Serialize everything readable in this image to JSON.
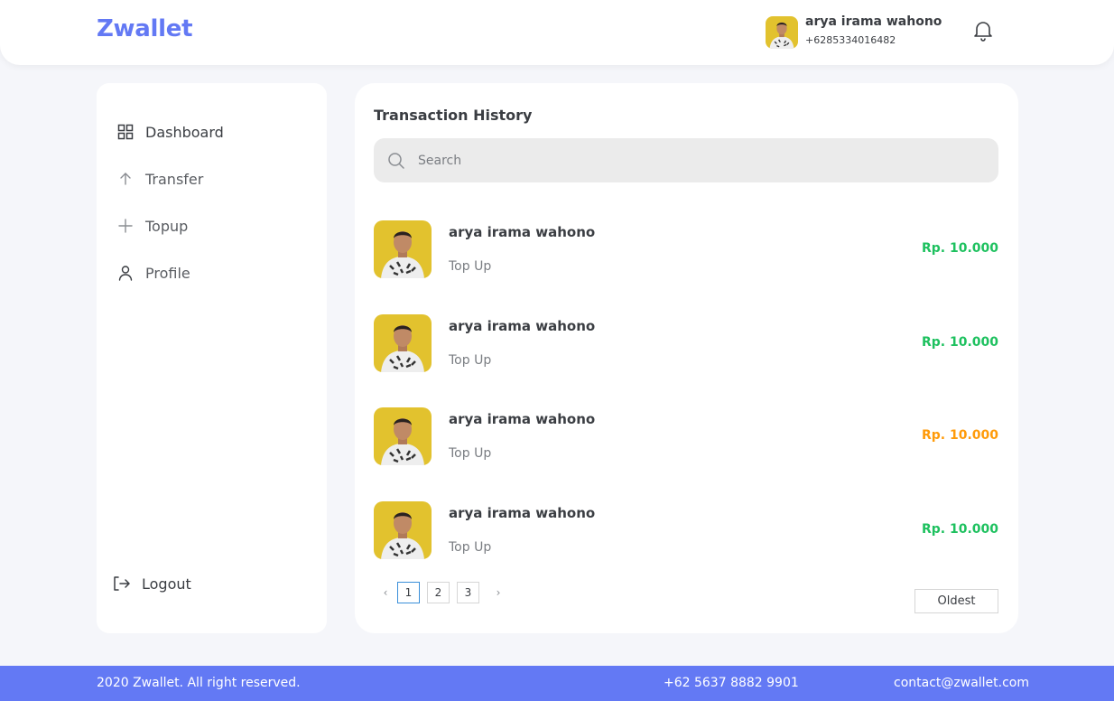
{
  "header": {
    "brand": "Zwallet",
    "user_name": "arya irama wahono",
    "user_phone": "+6285334016482",
    "bell_icon": "bell-icon"
  },
  "sidebar": {
    "items": [
      {
        "label": "Dashboard",
        "icon": "grid-icon"
      },
      {
        "label": "Transfer",
        "icon": "arrow-up-icon"
      },
      {
        "label": "Topup",
        "icon": "plus-icon"
      },
      {
        "label": "Profile",
        "icon": "user-icon"
      }
    ],
    "logout": {
      "label": "Logout",
      "icon": "logout-icon"
    }
  },
  "main": {
    "title": "Transaction History",
    "search_placeholder": "Search",
    "transactions": [
      {
        "name": "arya irama wahono",
        "type": "Top Up",
        "amount": "Rp. 10.000",
        "color": "#1ec15f"
      },
      {
        "name": "arya irama wahono",
        "type": "Top Up",
        "amount": "Rp. 10.000",
        "color": "#1ec15f"
      },
      {
        "name": "arya irama wahono",
        "type": "Top Up",
        "amount": "Rp. 10.000",
        "color": "#ff9b0a"
      },
      {
        "name": "arya irama wahono",
        "type": "Top Up",
        "amount": "Rp. 10.000",
        "color": "#1ec15f"
      }
    ],
    "pagination": {
      "prev": "‹",
      "next": "›",
      "pages": [
        "1",
        "2",
        "3"
      ],
      "current": "1"
    },
    "sort_label": "Oldest"
  },
  "footer": {
    "copyright": "2020 Zwallet. All right reserved.",
    "phone": "+62 5637 8882 9901",
    "email": "contact@zwallet.com"
  },
  "colors": {
    "accent": "#6379f4",
    "positive": "#1ec15f",
    "pending": "#ff9b0a"
  }
}
